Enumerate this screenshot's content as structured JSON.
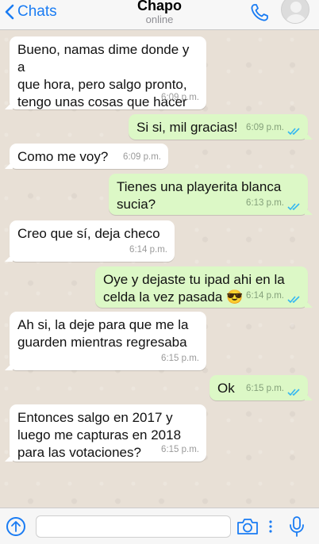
{
  "header": {
    "back_label": "Chats",
    "title": "Chapo",
    "status": "online"
  },
  "messages": [
    {
      "dir": "in",
      "text": "Bueno, namas dime donde y a\nque hora, pero salgo pronto,\ntengo unas cosas que hacer",
      "time": "6:09 p.m."
    },
    {
      "dir": "out",
      "text": "Si si, mil gracias!",
      "time": "6:09 p.m.",
      "read": true
    },
    {
      "dir": "in",
      "text": "Como me voy?",
      "time": "6:09 p.m."
    },
    {
      "dir": "out",
      "text": "Tienes una playerita blanca\nsucia?",
      "time": "6:13 p.m.",
      "read": true
    },
    {
      "dir": "in",
      "text": "Creo que sí, deja checo",
      "time": "6:14 p.m."
    },
    {
      "dir": "out",
      "text": "Oye y dejaste tu ipad ahi en la\nceldа la vez pasada 😎",
      "time": "6:14 p.m.",
      "read": true
    },
    {
      "dir": "in",
      "text": "Ah si, la deje para que me la\nguarden mientras regresaba",
      "time": "6:15 p.m."
    },
    {
      "dir": "out",
      "text": "Ok",
      "time": "6:15 p.m.",
      "read": true
    },
    {
      "dir": "in",
      "text": "Entonces salgo en 2017 y\nluego me capturas en 2018\npara las votaciones?",
      "time": "6:15 p.m."
    }
  ],
  "input": {
    "value": "",
    "placeholder": ""
  },
  "icons": {
    "back": "chevron-left-icon",
    "call": "phone-icon",
    "avatar": "avatar",
    "attach": "arrow-up-circle-icon",
    "camera": "camera-icon",
    "more": "more-vertical-icon",
    "mic": "microphone-icon",
    "read_receipt": "double-check-icon"
  },
  "colors": {
    "accent": "#1a7cf3",
    "incoming_bubble": "#ffffff",
    "outgoing_bubble": "#dcf8c6",
    "read_ticks": "#34b7f1",
    "chat_background": "#e8e0d6"
  }
}
